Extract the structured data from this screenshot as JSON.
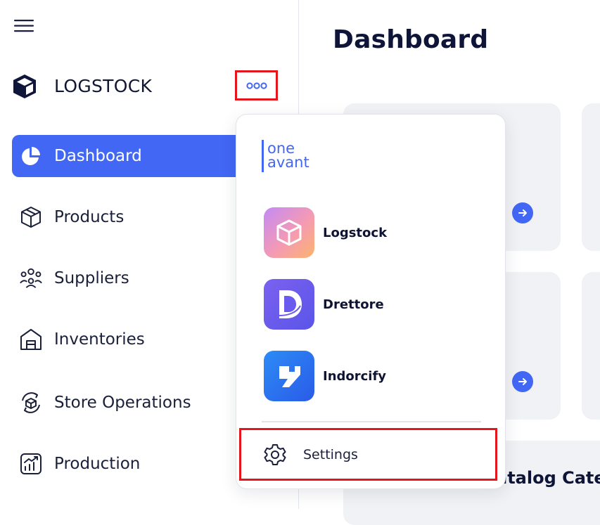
{
  "sidebar": {
    "brand": {
      "name": "LOGSTOCK",
      "icon": "cube-icon"
    },
    "nav": [
      {
        "label": "Dashboard",
        "icon": "pie-chart-icon",
        "active": true
      },
      {
        "label": "Products",
        "icon": "box-icon",
        "active": false
      },
      {
        "label": "Suppliers",
        "icon": "people-group-icon",
        "active": false
      },
      {
        "label": "Inventories",
        "icon": "warehouse-icon",
        "active": false
      },
      {
        "label": "Store Operations",
        "icon": "cycle-box-icon",
        "active": false
      },
      {
        "label": "Production",
        "icon": "growth-chart-icon",
        "active": false
      }
    ]
  },
  "main": {
    "title": "Dashboard",
    "section_title": "atalog Cate"
  },
  "app_switcher": {
    "logo_text": {
      "line1": "one",
      "line2": "avant"
    },
    "apps": [
      {
        "name": "Logstock",
        "icon": "logstock-app-icon"
      },
      {
        "name": "Drettore",
        "icon": "drettore-app-icon"
      },
      {
        "name": "Indorcify",
        "icon": "indorcify-app-icon"
      }
    ],
    "settings_label": "Settings"
  },
  "colors": {
    "accent": "#4267f5",
    "highlight": "#e5161b",
    "text_dark": "#0f1538",
    "card_bg": "#f1f2f5"
  }
}
